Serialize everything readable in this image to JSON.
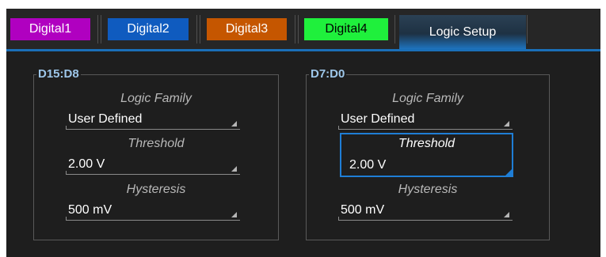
{
  "tabs": [
    {
      "label": "Digital1",
      "bg": "#b000c0",
      "fg": "#ffffff"
    },
    {
      "label": "Digital2",
      "bg": "#0f5bbf",
      "fg": "#ffffff"
    },
    {
      "label": "Digital3",
      "bg": "#c55600",
      "fg": "#ffffff"
    },
    {
      "label": "Digital4",
      "bg": "#1ff03c",
      "fg": "#000000"
    }
  ],
  "active_tab": {
    "label": "Logic Setup"
  },
  "groups": [
    {
      "title": "D15:D8",
      "family_label": "Logic Family",
      "family_value": "User Defined",
      "threshold_label": "Threshold",
      "threshold_value": "2.00 V",
      "hysteresis_label": "Hysteresis",
      "hysteresis_value": "500 mV"
    },
    {
      "title": "D7:D0",
      "family_label": "Logic Family",
      "family_value": "User Defined",
      "threshold_label": "Threshold",
      "threshold_value": "2.00 V",
      "hysteresis_label": "Hysteresis",
      "hysteresis_value": "500 mV"
    }
  ],
  "colors": {
    "accent": "#1f7ed6",
    "group_title": "#9ec7ea"
  }
}
